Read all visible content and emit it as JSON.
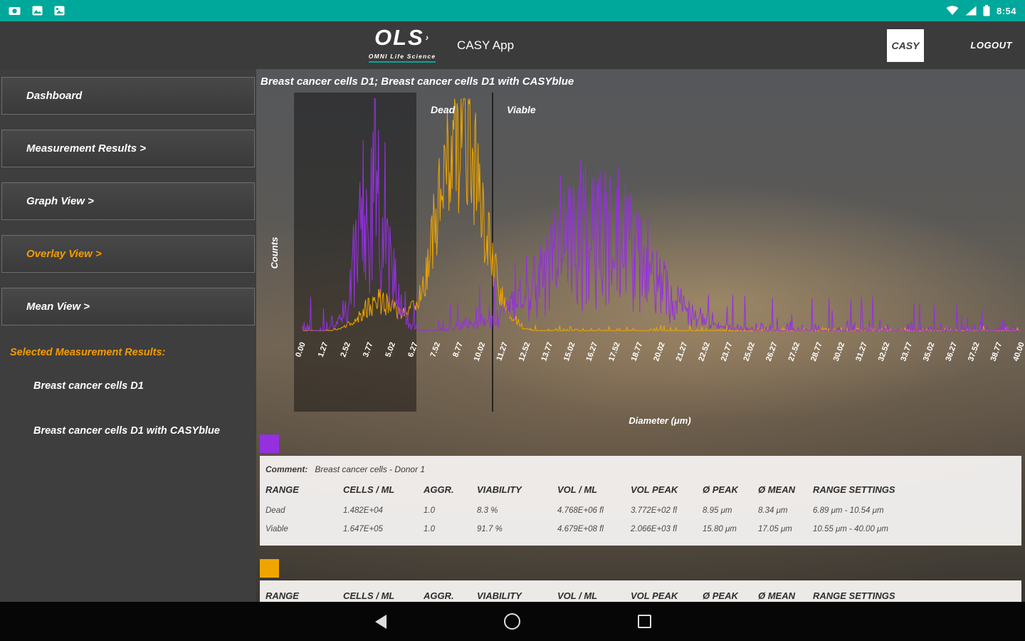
{
  "colors": {
    "status_bar": "#00A79B",
    "accent_orange": "#F59B00",
    "series_purple": "#9430E0",
    "series_yellow": "#EFA500"
  },
  "status_bar": {
    "time": "8:54"
  },
  "header": {
    "logo": "OLS",
    "logo_mark": "›",
    "logo_sub": "OMNI Life Science",
    "app_title": "CASY App",
    "casy_button": "CASY",
    "logout_label": "LOGOUT"
  },
  "sidebar": {
    "items": [
      {
        "label": "Dashboard"
      },
      {
        "label": "Measurement Results >"
      },
      {
        "label": "Graph View >"
      },
      {
        "label": "Overlay View >"
      },
      {
        "label": "Mean View >"
      }
    ],
    "selected_header": "Selected Measurement Results:",
    "selected": [
      "Breast cancer cells D1",
      "Breast cancer cells D1 with CASYblue"
    ]
  },
  "chart": {
    "title": "Breast cancer cells D1; Breast cancer cells D1 with CASYblue",
    "dead_label": "Dead",
    "viable_label": "Viable",
    "xlabel": "Diameter (μm)",
    "ylabel": "Counts"
  },
  "chart_data": {
    "type": "line",
    "title": "Breast cancer cells D1; Breast cancer cells D1 with CASYblue",
    "xlabel": "Diameter (μm)",
    "ylabel": "Counts",
    "x_range": [
      0,
      40
    ],
    "x_ticks": [
      "0.00",
      "1.27",
      "2.52",
      "3.77",
      "5.02",
      "6.27",
      "7.52",
      "8.77",
      "10.02",
      "11.27",
      "12.52",
      "13.77",
      "15.02",
      "16.27",
      "17.52",
      "18.77",
      "20.02",
      "21.27",
      "22.52",
      "23.77",
      "25.02",
      "26.27",
      "27.52",
      "28.77",
      "30.02",
      "31.27",
      "32.52",
      "33.77",
      "35.02",
      "36.27",
      "37.52",
      "38.77",
      "40.00"
    ],
    "regions": {
      "shaded_range": [
        0,
        6.27
      ],
      "dead_viable_boundary": 10.54
    },
    "series": [
      {
        "name": "Breast cancer cells D1",
        "color": "#9430E0",
        "jitter": 0.8,
        "clutter": 0.07,
        "peaks": [
          {
            "center": 3.9,
            "sigma": 0.8,
            "amp": 0.62
          },
          {
            "center": 16.4,
            "sigma": 2.8,
            "amp": 0.4
          }
        ]
      },
      {
        "name": "Breast cancer cells D1 with CASYblue",
        "color": "#EFA500",
        "jitter": 0.45,
        "clutter": 0.03,
        "peaks": [
          {
            "center": 8.8,
            "sigma": 1.2,
            "amp": 0.88
          },
          {
            "center": 4.3,
            "sigma": 1.0,
            "amp": 0.12
          }
        ]
      }
    ]
  },
  "results": [
    {
      "swatch_color": "#9430E0",
      "comment_label": "Comment:",
      "comment": "Breast cancer cells - Donor 1",
      "headers": [
        "RANGE",
        "CELLS / ML",
        "AGGR.",
        "VIABILITY",
        "VOL / ML",
        "VOL PEAK",
        "Ø PEAK",
        "Ø MEAN",
        "RANGE SETTINGS"
      ],
      "rows": [
        {
          "cells": [
            "Dead",
            "1.482E+04",
            "1.0",
            "8.3 %",
            "4.768E+06 fl",
            "3.772E+02 fl",
            "8.95 μm",
            "8.34 μm",
            "6.89 μm - 10.54 μm"
          ]
        },
        {
          "cells": [
            "Viable",
            "1.647E+05",
            "1.0",
            "91.7 %",
            "4.679E+08 fl",
            "2.066E+03 fl",
            "15.80 μm",
            "17.05 μm",
            "10.55 μm - 40.00 μm"
          ]
        }
      ]
    },
    {
      "swatch_color": "#EFA500",
      "headers": [
        "RANGE",
        "CELLS / ML",
        "AGGR.",
        "VIABILITY",
        "VOL / ML",
        "VOL PEAK",
        "Ø PEAK",
        "Ø MEAN",
        "RANGE SETTINGS"
      ],
      "rows": []
    }
  ]
}
